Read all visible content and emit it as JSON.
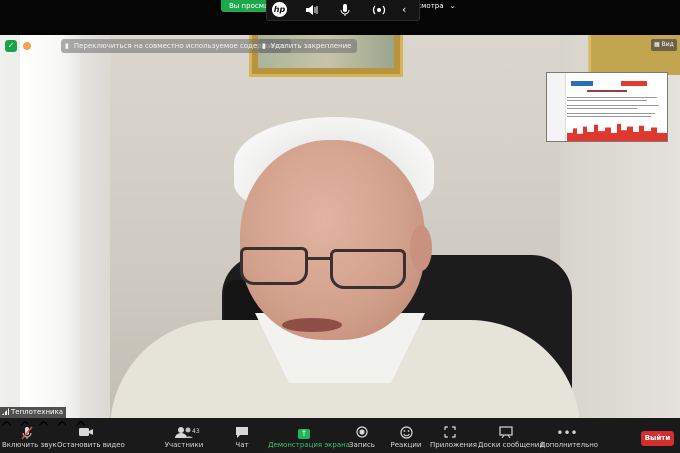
{
  "top": {
    "viewing_notice": "Вы просмат",
    "view_options": "осмотра",
    "hp_logo": "hp",
    "hp_icons": [
      "speaker-icon",
      "microphone-icon",
      "broadcast-icon",
      "chevron-left-icon"
    ]
  },
  "overlay": {
    "secure_icon": "shield-icon",
    "switch_shared": "Переключиться на совместно используемое содержимое",
    "remove_pin": "Удалить закрепление",
    "view_label": "Вид"
  },
  "video": {
    "participant_name": "Теплотехника"
  },
  "toolbar": {
    "unmute": "Включить звук",
    "stop_video": "Остановить видео",
    "participants": "Участники",
    "participants_count": "43",
    "chat": "Чат",
    "share_screen": "Демонстрация экрана",
    "record": "Запись",
    "reactions": "Реакции",
    "apps": "Приложения",
    "whiteboards": "Доски сообщений",
    "more": "Дополнительно",
    "leave": "Выйти"
  },
  "colors": {
    "accent_green": "#22b45a",
    "leave_red": "#d42e2e",
    "toolbar_bg": "#1a1a1a"
  }
}
